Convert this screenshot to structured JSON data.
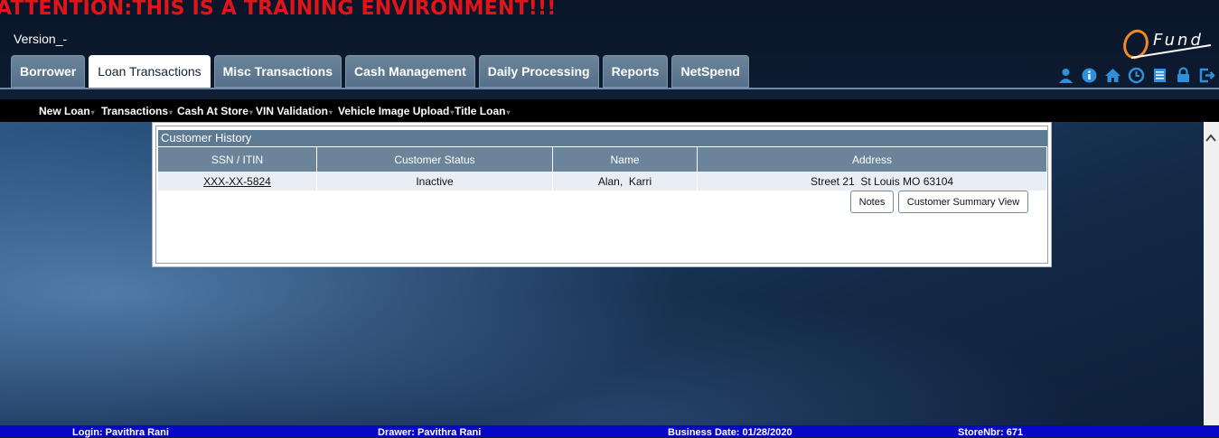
{
  "banner": {
    "attention": "ATTENTION:THIS IS A TRAINING ENVIRONMENT!!!"
  },
  "header": {
    "version": "Version_-",
    "logo_text": "Fund"
  },
  "tabs": [
    {
      "label": "Borrower",
      "active": false
    },
    {
      "label": "Loan Transactions",
      "active": true
    },
    {
      "label": "Misc Transactions",
      "active": false
    },
    {
      "label": "Cash Management",
      "active": false
    },
    {
      "label": "Daily Processing",
      "active": false
    },
    {
      "label": "Reports",
      "active": false
    },
    {
      "label": "NetSpend",
      "active": false
    }
  ],
  "toolbar_icons": [
    "user-icon",
    "info-icon",
    "home-icon",
    "clock-icon",
    "document-icon",
    "lock-icon",
    "logout-icon"
  ],
  "submenu": [
    {
      "label": "New Loan"
    },
    {
      "label": "Transactions"
    },
    {
      "label": "Cash At Store"
    },
    {
      "label": "VIN Validation"
    },
    {
      "label": "Vehicle Image Upload"
    },
    {
      "label": "Title Loan"
    }
  ],
  "customer_history": {
    "title": "Customer History",
    "columns": [
      "SSN / ITIN",
      "Customer Status",
      "Name",
      "Address"
    ],
    "rows": [
      {
        "ssn": "XXX-XX-5824",
        "status": "Inactive",
        "name": "Alan,  Karri",
        "address": "Street 21  St Louis MO 63104"
      }
    ],
    "buttons": {
      "notes": "Notes",
      "summary": "Customer Summary View"
    }
  },
  "status_bar": {
    "login": "Login: Pavithra Rani",
    "drawer": "Drawer: Pavithra Rani",
    "business_date": "Business Date: 01/28/2020",
    "store": "StoreNbr: 671"
  },
  "colors": {
    "attention": "#e2141a",
    "tab": "#5f7a92",
    "status_bar": "#0707c9"
  }
}
